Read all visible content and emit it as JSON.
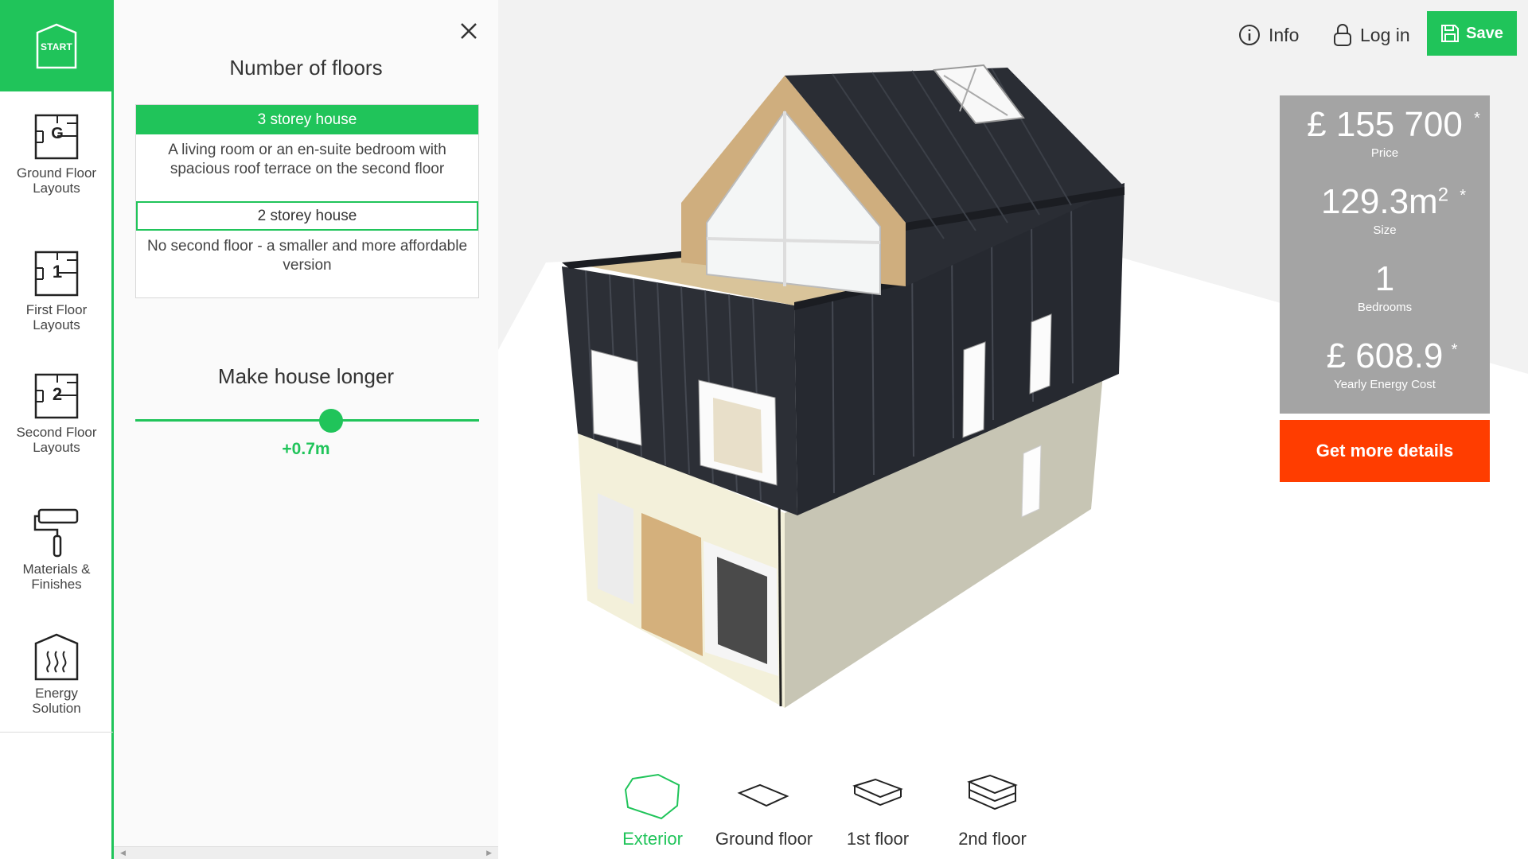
{
  "colors": {
    "accent": "#20c45a",
    "cta": "#ff3d00",
    "stats_bg": "#a4a4a4"
  },
  "nav": {
    "start_label": "START",
    "items": [
      {
        "label": "Ground Floor Layouts",
        "icon": "ground-floor-plan-icon"
      },
      {
        "label": "First Floor Layouts",
        "icon": "first-floor-plan-icon"
      },
      {
        "label": "Second Floor Layouts",
        "icon": "second-floor-plan-icon"
      },
      {
        "label": "Materials & Finishes",
        "icon": "paint-roller-icon"
      },
      {
        "label": "Energy Solution",
        "icon": "heating-icon"
      }
    ]
  },
  "panel": {
    "floors_title": "Number of floors",
    "options": [
      {
        "label": "3 storey house",
        "description": "A living room or an en-suite bedroom with spacious roof terrace on the second floor",
        "selected": true
      },
      {
        "label": "2 storey house",
        "description": "No second floor - a smaller and more affordable version",
        "selected": false
      }
    ],
    "length_title": "Make house longer",
    "length_value": "+0.7m",
    "length_slider_fraction": 0.57
  },
  "topbar": {
    "info_label": "Info",
    "login_label": "Log in",
    "save_label": "Save"
  },
  "stats": {
    "price_value": "£ 155 700",
    "price_label": "Price",
    "size_value": "129.3m",
    "size_sup": "2",
    "size_label": "Size",
    "bedrooms_value": "1",
    "bedrooms_label": "Bedrooms",
    "energy_value": "£ 608.9",
    "energy_label": "Yearly Energy Cost",
    "asterisk": "*"
  },
  "details_button": "Get more details",
  "views": [
    {
      "label": "Exterior",
      "icon": "exterior-view-icon",
      "active": true
    },
    {
      "label": "Ground floor",
      "icon": "ground-floor-view-icon",
      "active": false
    },
    {
      "label": "1st floor",
      "icon": "first-floor-view-icon",
      "active": false
    },
    {
      "label": "2nd floor",
      "icon": "second-floor-view-icon",
      "active": false
    }
  ]
}
